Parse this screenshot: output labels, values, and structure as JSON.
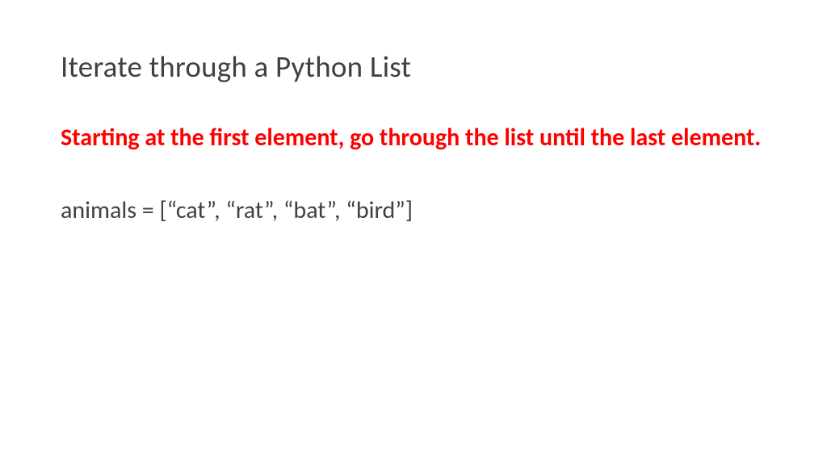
{
  "slide": {
    "title": "Iterate through a Python List",
    "description": "Starting at the first element, go through the list until the last element.",
    "code": "animals = [“cat”, “rat”, “bat”, “bird”]"
  }
}
